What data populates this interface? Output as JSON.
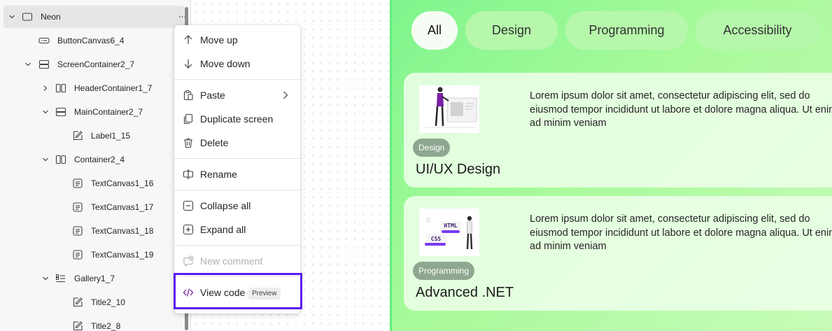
{
  "tree": {
    "items": [
      {
        "label": "Neon",
        "icon": "screen-icon",
        "expanded": true
      },
      {
        "label": "ButtonCanvas6_4",
        "icon": "button-icon"
      },
      {
        "label": "ScreenContainer2_7",
        "icon": "vertical-container-icon",
        "expanded": true
      },
      {
        "label": "HeaderContainer1_7",
        "icon": "horizontal-container-icon",
        "expanded": false
      },
      {
        "label": "MainContainer2_7",
        "icon": "vertical-container-icon",
        "expanded": true
      },
      {
        "label": "Label1_15",
        "icon": "label-edit-icon"
      },
      {
        "label": "Container2_4",
        "icon": "horizontal-container-icon",
        "expanded": true
      },
      {
        "label": "TextCanvas1_16",
        "icon": "text-icon"
      },
      {
        "label": "TextCanvas1_17",
        "icon": "text-icon"
      },
      {
        "label": "TextCanvas1_18",
        "icon": "text-icon"
      },
      {
        "label": "TextCanvas1_19",
        "icon": "text-icon"
      },
      {
        "label": "Gallery1_7",
        "icon": "gallery-icon",
        "expanded": true
      },
      {
        "label": "Title2_10",
        "icon": "label-edit-icon"
      },
      {
        "label": "Title2_8",
        "icon": "label-edit-icon"
      }
    ],
    "more_label": "···"
  },
  "menu": {
    "move_up": "Move up",
    "move_down": "Move down",
    "paste": "Paste",
    "duplicate_screen": "Duplicate screen",
    "delete": "Delete",
    "rename": "Rename",
    "collapse_all": "Collapse all",
    "expand_all": "Expand all",
    "new_comment": "New comment",
    "view_code": "View code",
    "preview_badge": "Preview"
  },
  "app": {
    "filters": [
      "All",
      "Design",
      "Programming",
      "Accessibility"
    ],
    "active_filter": "All",
    "cards": [
      {
        "badge": "Design",
        "title": "UI/UX Design",
        "description": "Lorem ipsum dolor sit amet, consectetur adipiscing elit, sed do eiusmod tempor incididunt ut labore et dolore magna aliqua. Ut enim ad minim veniam"
      },
      {
        "badge": "Programming",
        "title": "Advanced .NET",
        "description": "Lorem ipsum dolor sit amet, consectetur adipiscing elit, sed do eiusmod tempor incididunt ut labore et dolore magna aliqua. Ut enim ad minim veniam",
        "thumb_html": "HTML",
        "thumb_css": "CSS"
      }
    ]
  },
  "colors": {
    "highlight_border": "#5a1cf0",
    "view_code_icon": "#7a1fa2",
    "neon_green": "#7ff58d",
    "badge": "#8fa790"
  }
}
